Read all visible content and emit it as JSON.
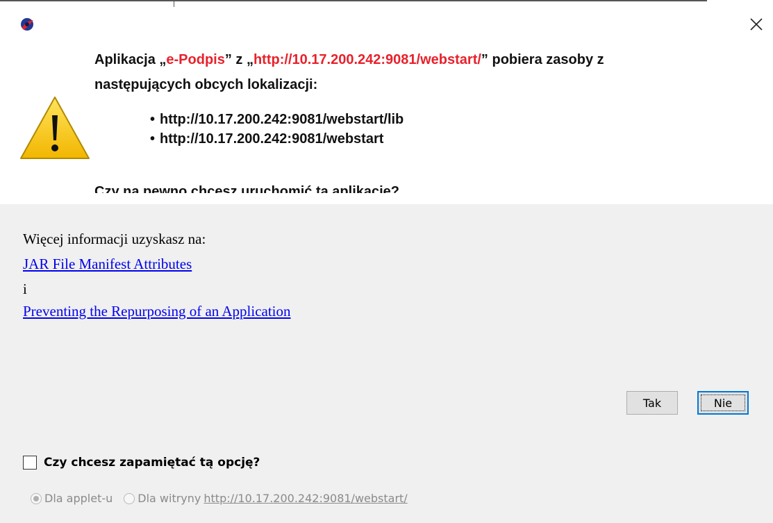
{
  "dialog": {
    "app_icon": "java-icon",
    "close_icon": "close-icon",
    "warning_icon": "warning-triangle-icon"
  },
  "message": {
    "line1_prefix": "Aplikacja „",
    "app_name": "e-Podpis",
    "line1_mid": "” z „",
    "app_url": "http://10.17.200.242:9081/webstart/",
    "line1_suffix": "” pobiera zasoby z",
    "line2": "następujących obcych lokalizacji:",
    "locations": [
      "http://10.17.200.242:9081/webstart/lib",
      "http://10.17.200.242:9081/webstart"
    ],
    "question": "Czy na pewno chcesz uruchomić tą aplikację?"
  },
  "info": {
    "more_info": "Więcej informacji uzyskasz na:",
    "link1": "JAR File Manifest Attributes",
    "conjunction": "i",
    "link2": "Preventing the Repurposing of an Application"
  },
  "buttons": {
    "yes": "Tak",
    "no": "Nie"
  },
  "remember": {
    "checkbox_label": "Czy chcesz zapamiętać tą opcję?",
    "checked": false,
    "option1": "Dla applet-u",
    "option2": "Dla witryny",
    "option2_url": "http://10.17.200.242:9081/webstart/",
    "selected": "option1"
  }
}
